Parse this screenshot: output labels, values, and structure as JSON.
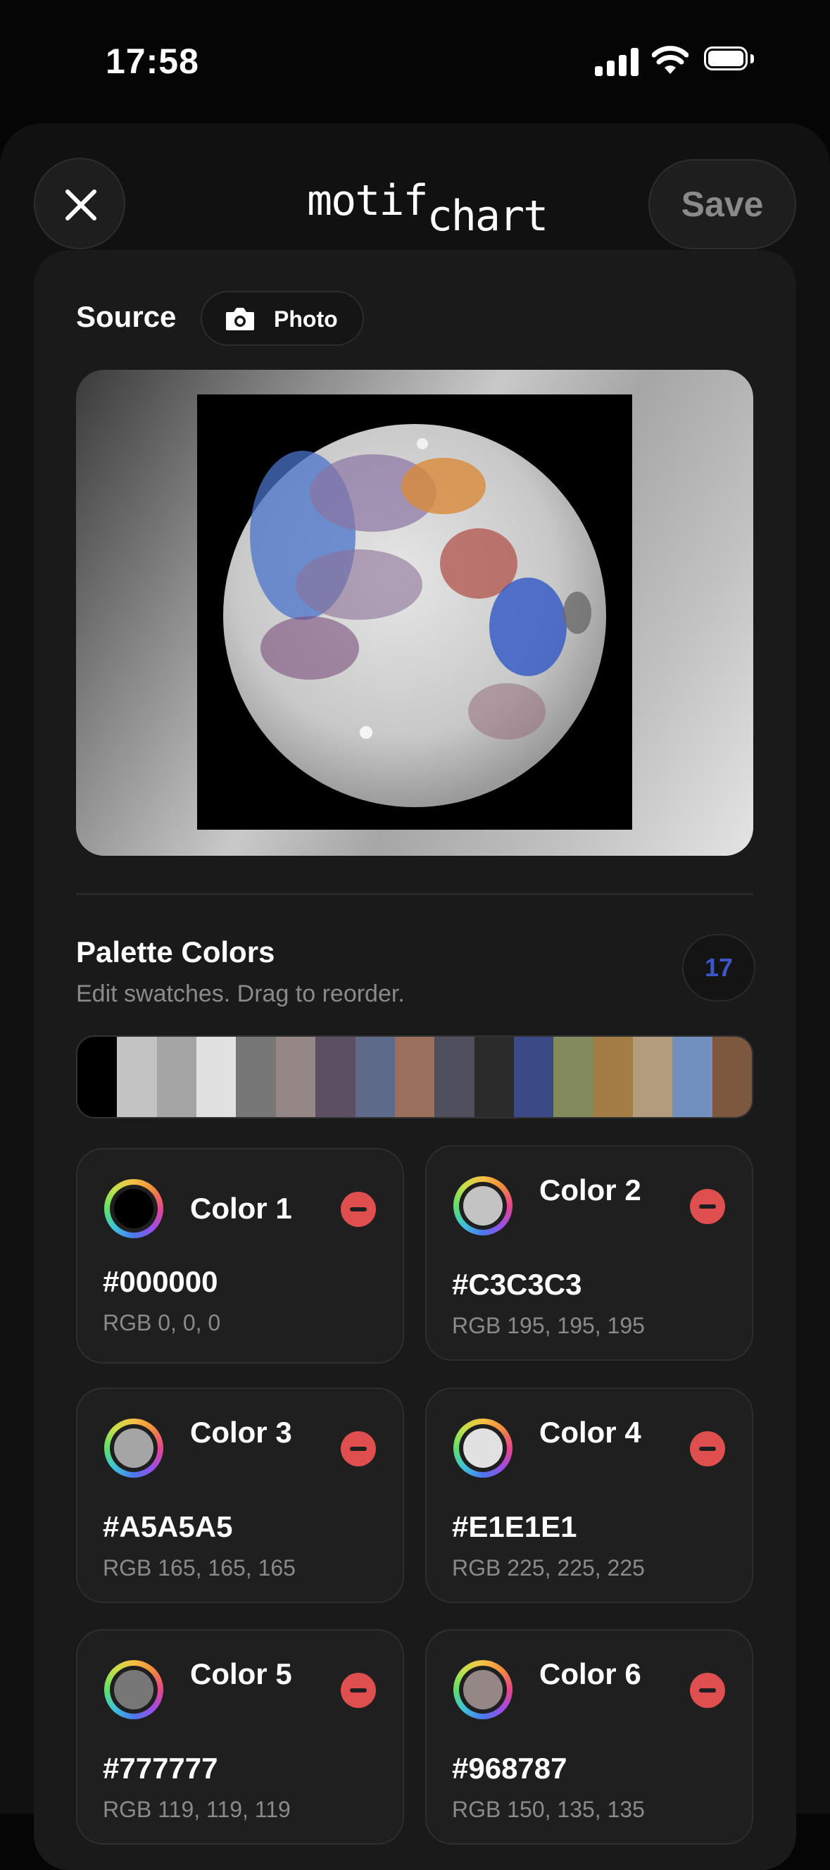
{
  "status": {
    "time": "17:58"
  },
  "header": {
    "close_icon": "close-icon",
    "logo_main": "motif",
    "logo_sub": "chart",
    "save_label": "Save"
  },
  "source": {
    "label": "Source",
    "chip_icon": "camera-icon",
    "chip_label": "Photo"
  },
  "palette": {
    "title": "Palette Colors",
    "subtitle": "Edit swatches. Drag to reorder.",
    "count": "17",
    "strip": [
      "#000000",
      "#C3C3C3",
      "#A5A5A5",
      "#E1E1E1",
      "#777777",
      "#968787",
      "#5C4F62",
      "#5E6A8A",
      "#98705C",
      "#4F4F5E",
      "#2B2B2B",
      "#3B4A86",
      "#838A5E",
      "#A37C46",
      "#B39B7D",
      "#7290BF",
      "#7E573F"
    ],
    "colors": [
      {
        "name": "Color 1",
        "hex": "#000000",
        "rgb": "RGB 0, 0, 0"
      },
      {
        "name": "Color 2",
        "hex": "#C3C3C3",
        "rgb": "RGB 195, 195, 195"
      },
      {
        "name": "Color 3",
        "hex": "#A5A5A5",
        "rgb": "RGB 165, 165, 165"
      },
      {
        "name": "Color 4",
        "hex": "#E1E1E1",
        "rgb": "RGB 225, 225, 225"
      },
      {
        "name": "Color 5",
        "hex": "#777777",
        "rgb": "RGB 119, 119, 119"
      },
      {
        "name": "Color 6",
        "hex": "#968787",
        "rgb": "RGB 150, 135, 135"
      }
    ]
  }
}
